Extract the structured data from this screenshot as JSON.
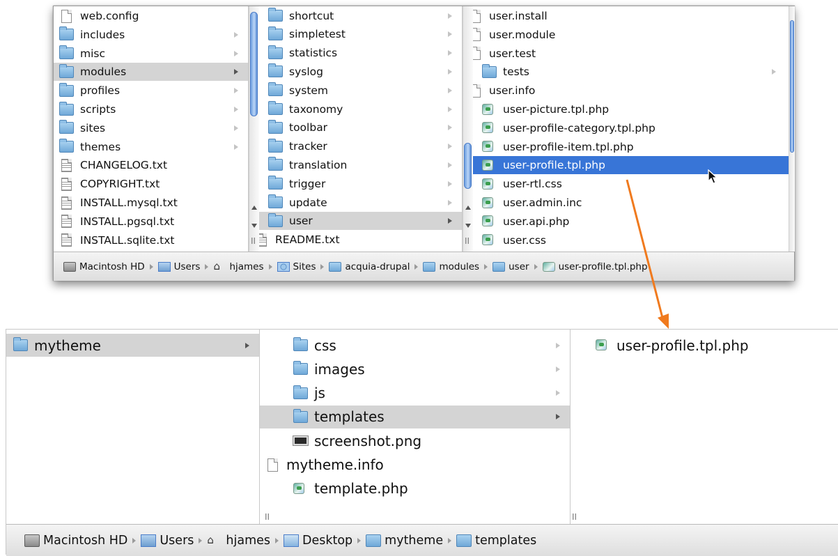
{
  "top_window": {
    "col1": [
      {
        "label": "web.config",
        "icon": "document-icon",
        "arrow": false
      },
      {
        "label": "includes",
        "icon": "folder-icon",
        "arrow": true
      },
      {
        "label": "misc",
        "icon": "folder-icon",
        "arrow": true
      },
      {
        "label": "modules",
        "icon": "folder-icon",
        "arrow": true,
        "selected": "gray"
      },
      {
        "label": "profiles",
        "icon": "folder-icon",
        "arrow": true
      },
      {
        "label": "scripts",
        "icon": "folder-icon",
        "arrow": true
      },
      {
        "label": "sites",
        "icon": "folder-icon",
        "arrow": true
      },
      {
        "label": "themes",
        "icon": "folder-icon",
        "arrow": true
      },
      {
        "label": "CHANGELOG.txt",
        "icon": "text-file-icon",
        "arrow": false
      },
      {
        "label": "COPYRIGHT.txt",
        "icon": "text-file-icon",
        "arrow": false
      },
      {
        "label": "INSTALL.mysql.txt",
        "icon": "text-file-icon",
        "arrow": false
      },
      {
        "label": "INSTALL.pgsql.txt",
        "icon": "text-file-icon",
        "arrow": false
      },
      {
        "label": "INSTALL.sqlite.txt",
        "icon": "text-file-icon",
        "arrow": false
      }
    ],
    "col2": [
      {
        "label": "shortcut",
        "icon": "folder-icon",
        "arrow": true
      },
      {
        "label": "simpletest",
        "icon": "folder-icon",
        "arrow": true
      },
      {
        "label": "statistics",
        "icon": "folder-icon",
        "arrow": true
      },
      {
        "label": "syslog",
        "icon": "folder-icon",
        "arrow": true
      },
      {
        "label": "system",
        "icon": "folder-icon",
        "arrow": true
      },
      {
        "label": "taxonomy",
        "icon": "folder-icon",
        "arrow": true
      },
      {
        "label": "toolbar",
        "icon": "folder-icon",
        "arrow": true
      },
      {
        "label": "tracker",
        "icon": "folder-icon",
        "arrow": true
      },
      {
        "label": "translation",
        "icon": "folder-icon",
        "arrow": true
      },
      {
        "label": "trigger",
        "icon": "folder-icon",
        "arrow": true
      },
      {
        "label": "update",
        "icon": "folder-icon",
        "arrow": true
      },
      {
        "label": "user",
        "icon": "folder-icon",
        "arrow": true,
        "selected": "gray"
      },
      {
        "label": "README.txt",
        "icon": "text-file-icon",
        "arrow": false
      }
    ],
    "col3": [
      {
        "label": "user.install",
        "icon": "document-icon",
        "arrow": false
      },
      {
        "label": "user.module",
        "icon": "document-icon",
        "arrow": false
      },
      {
        "label": "user.test",
        "icon": "document-icon",
        "arrow": false
      },
      {
        "label": "tests",
        "icon": "folder-icon",
        "arrow": true
      },
      {
        "label": "user.info",
        "icon": "document-icon",
        "arrow": false
      },
      {
        "label": "user-picture.tpl.php",
        "icon": "php-file-icon",
        "arrow": false
      },
      {
        "label": "user-profile-category.tpl.php",
        "icon": "php-file-icon",
        "arrow": false
      },
      {
        "label": "user-profile-item.tpl.php",
        "icon": "php-file-icon",
        "arrow": false
      },
      {
        "label": "user-profile.tpl.php",
        "icon": "php-file-icon",
        "arrow": false,
        "selected": "blue"
      },
      {
        "label": "user-rtl.css",
        "icon": "php-file-icon",
        "arrow": false
      },
      {
        "label": "user.admin.inc",
        "icon": "php-file-icon",
        "arrow": false
      },
      {
        "label": "user.api.php",
        "icon": "php-file-icon",
        "arrow": false
      },
      {
        "label": "user.css",
        "icon": "php-file-icon",
        "arrow": false
      }
    ],
    "path": [
      {
        "label": "Macintosh HD",
        "icon": "hard-drive-icon"
      },
      {
        "label": "Users",
        "icon": "users-folder-icon"
      },
      {
        "label": "hjames",
        "icon": "home-icon"
      },
      {
        "label": "Sites",
        "icon": "sites-folder-icon"
      },
      {
        "label": "acquia-drupal",
        "icon": "folder-icon"
      },
      {
        "label": "modules",
        "icon": "folder-icon"
      },
      {
        "label": "user",
        "icon": "folder-icon"
      },
      {
        "label": "user-profile.tpl.php",
        "icon": "php-file-icon"
      }
    ]
  },
  "bottom_window": {
    "col1": [
      {
        "label": "mytheme",
        "icon": "folder-icon",
        "arrow": true,
        "selected": "gray"
      }
    ],
    "col2": [
      {
        "label": "css",
        "icon": "folder-icon",
        "arrow": true
      },
      {
        "label": "images",
        "icon": "folder-icon",
        "arrow": true
      },
      {
        "label": "js",
        "icon": "folder-icon",
        "arrow": true
      },
      {
        "label": "templates",
        "icon": "folder-icon",
        "arrow": true,
        "selected": "gray"
      },
      {
        "label": "screenshot.png",
        "icon": "image-file-icon",
        "arrow": false
      },
      {
        "label": "mytheme.info",
        "icon": "document-icon",
        "arrow": false
      },
      {
        "label": "template.php",
        "icon": "php-file-icon",
        "arrow": false
      }
    ],
    "col3": [
      {
        "label": "user-profile.tpl.php",
        "icon": "php-file-icon",
        "arrow": false
      }
    ],
    "path": [
      {
        "label": "Macintosh HD",
        "icon": "hard-drive-icon"
      },
      {
        "label": "Users",
        "icon": "users-folder-icon"
      },
      {
        "label": "hjames",
        "icon": "home-icon"
      },
      {
        "label": "Desktop",
        "icon": "desktop-folder-icon"
      },
      {
        "label": "mytheme",
        "icon": "folder-icon"
      },
      {
        "label": "templates",
        "icon": "folder-icon"
      }
    ]
  },
  "colors": {
    "selection_blue": "#3875d7",
    "selection_gray": "#d4d4d4",
    "drag_arrow": "#f07a1e"
  }
}
